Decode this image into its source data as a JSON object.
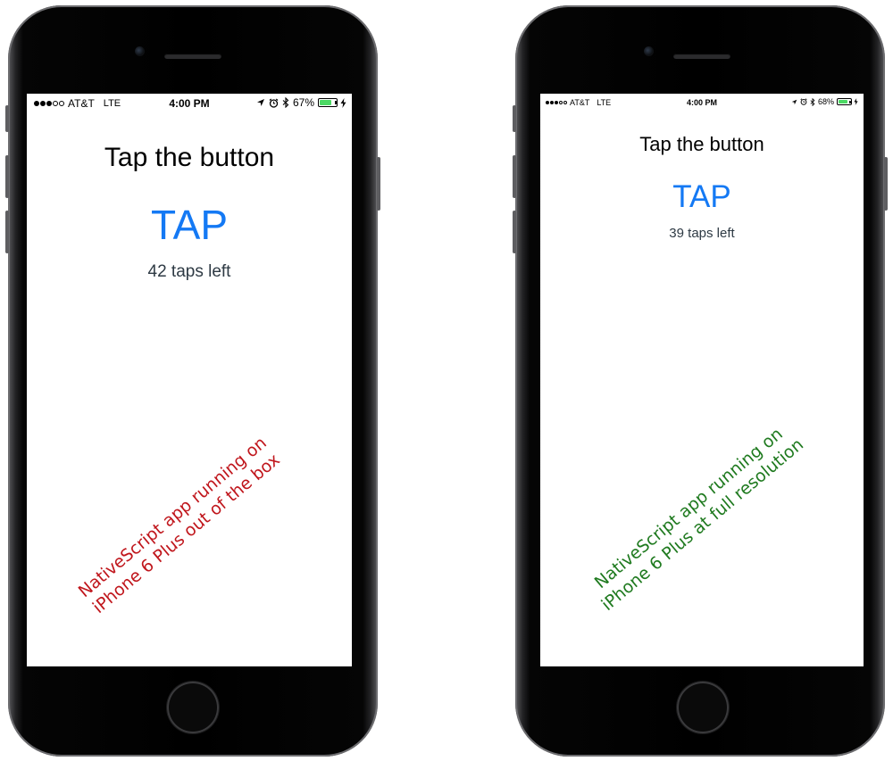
{
  "left_phone": {
    "status": {
      "carrier": "AT&T",
      "network": "LTE",
      "time": "4:00 PM",
      "battery": "67%",
      "battery_level": 0.67
    },
    "prompt": "Tap the button",
    "tap_label": "TAP",
    "counter": "42 taps left",
    "caption": {
      "line1": "NativeScript app running on",
      "line2": "iPhone 6 Plus out of the box",
      "color": "#c0161c"
    }
  },
  "right_phone": {
    "status": {
      "carrier": "AT&T",
      "network": "LTE",
      "time": "4:00 PM",
      "battery": "68%",
      "battery_level": 0.68
    },
    "prompt": "Tap the button",
    "tap_label": "TAP",
    "counter": "39 taps left",
    "caption": {
      "line1": "NativeScript app running on",
      "line2": "iPhone 6 Plus at full resolution",
      "color": "#1f7a1f"
    }
  },
  "colors": {
    "accent": "#1479f4",
    "battery_green": "#4cd964"
  }
}
